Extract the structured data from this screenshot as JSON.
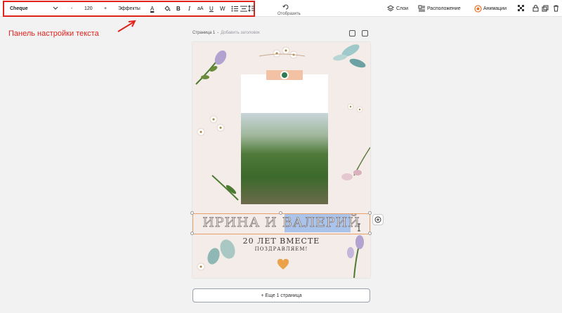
{
  "toolbar": {
    "font_name": "Cheque",
    "font_size": "120",
    "minus": "-",
    "plus": "+",
    "effects_label": "Эффекты",
    "bold": "B",
    "italic": "I",
    "underline": "U",
    "strike": "W",
    "case": "aA",
    "text_color": "A",
    "mirror_label": "Отобразить",
    "layers_label": "Слои",
    "arrange_label": "Расположение",
    "animation_label": "Анимации"
  },
  "annotation": {
    "text": "Панель настройки текста",
    "color": "#e0241b"
  },
  "page": {
    "label": "Страница 1",
    "separator": "-",
    "add_title": "Добавить заголовок"
  },
  "card": {
    "names": "ИРИНА И ВАЛЕРИЙ",
    "years": "20 ЛЕТ ВМЕСТЕ",
    "sub": "ПОЗДРАВЛЯЕМ!"
  },
  "footer": {
    "add_page": "+ Еще 1 страница"
  },
  "colors": {
    "accent_red": "#e0241b",
    "animation_orange": "#e8742a",
    "selection_blue": "#a9c3ea"
  }
}
